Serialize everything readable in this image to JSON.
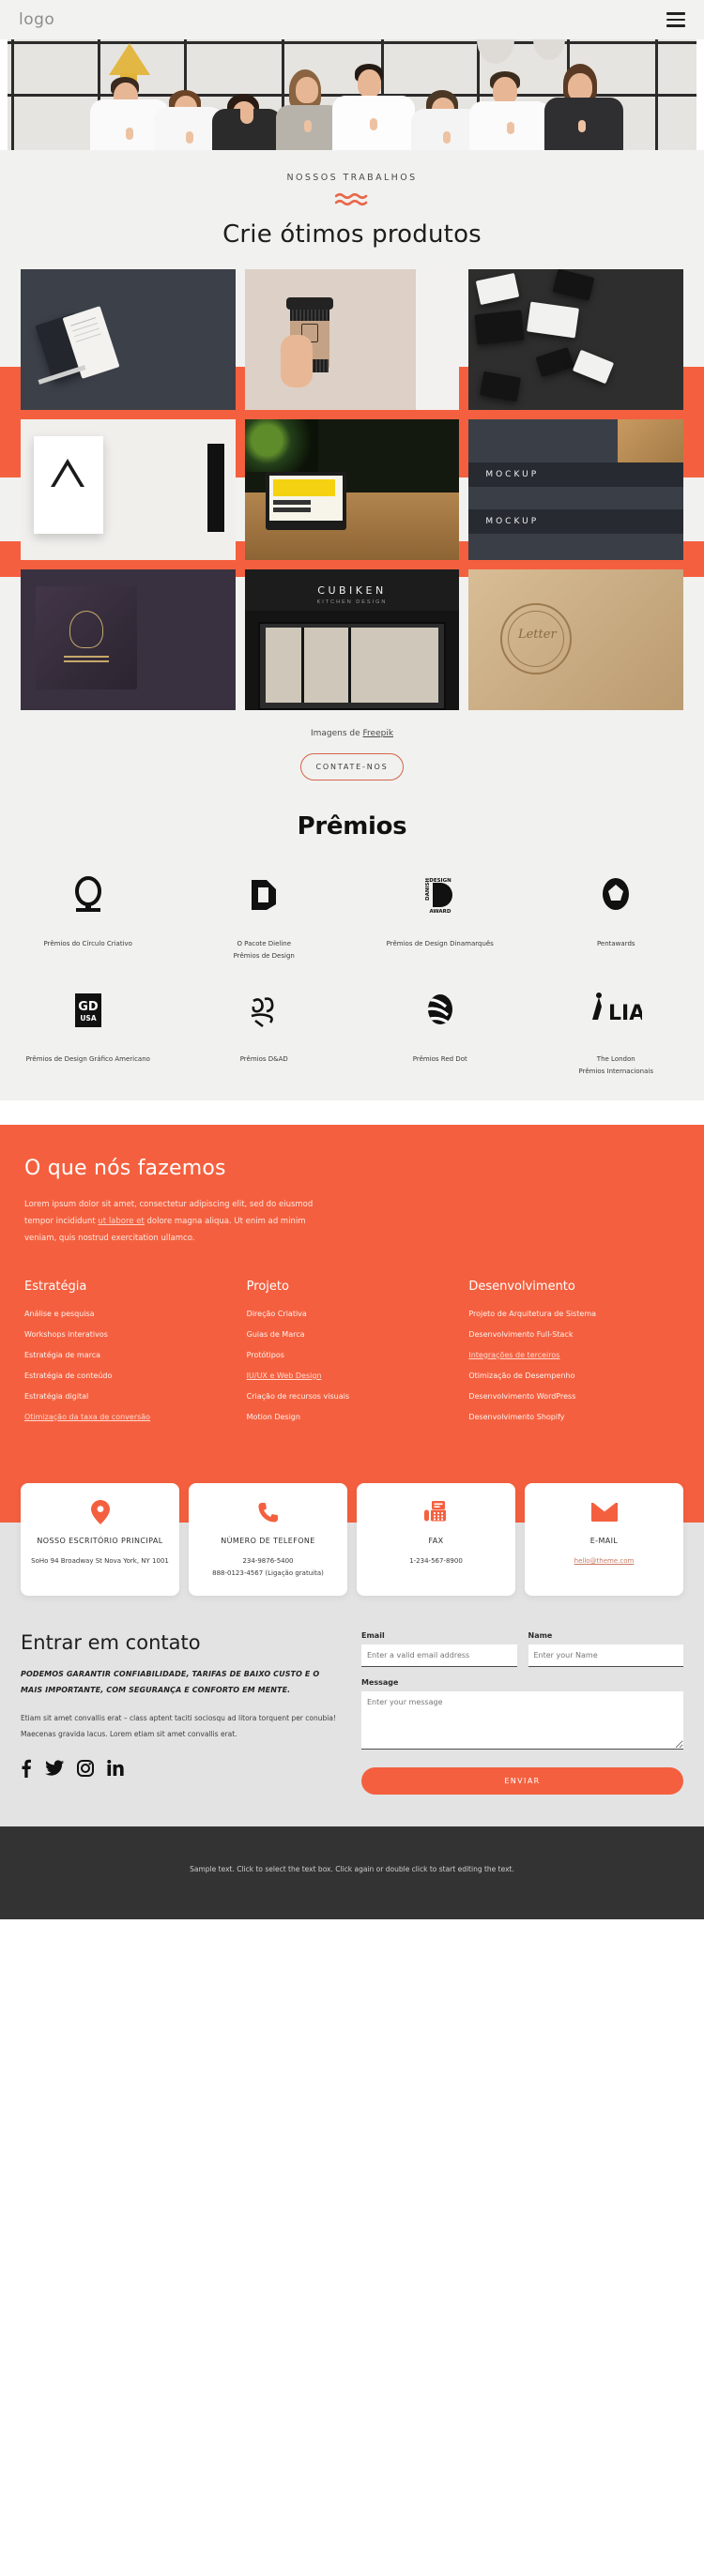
{
  "nav": {
    "logo": "logo",
    "menu_icon": "hamburger-icon"
  },
  "hero": {
    "alt": "team giving thumbs up"
  },
  "works": {
    "eyebrow": "NOSSOS TRABALHOS",
    "title": "Crie ótimos produtos",
    "credit_prefix": "Imagens de ",
    "credit_link": "Freepik",
    "cta": "CONTATE-NOS",
    "tiles": [
      "branding stationery dark",
      "coffee cup mockup",
      "business cards scattered",
      "triangle poster mockup",
      "laptop marketing strategy",
      "mockup banner wood",
      "blue horse club notebook",
      "cubiken kitchen design storefront",
      "letter press kraft stamp"
    ]
  },
  "prizes": {
    "title": "Prêmios",
    "row1": [
      {
        "logo": "creative-circle-icon",
        "label": "Prêmios do Círculo Criativo"
      },
      {
        "logo": "dieline-d-icon",
        "label": "O Pacote Dieline\nPrêmios de Design"
      },
      {
        "logo": "danish-design-award-icon",
        "label": "Prêmios de Design Dinamarquês"
      },
      {
        "logo": "pentawards-icon",
        "label": "Pentawards"
      }
    ],
    "row2": [
      {
        "logo": "gdusa-icon",
        "label": "Prêmios de Design Gráfico Americano"
      },
      {
        "logo": "dand-ad-icon",
        "label": "Prêmios D&AD"
      },
      {
        "logo": "red-dot-icon",
        "label": "Prêmios Red Dot"
      },
      {
        "logo": "lia-icon",
        "label": "The London\nPrêmios Internacionais"
      }
    ]
  },
  "services": {
    "title": "O que nós fazemos",
    "lead_part1": "Lorem ipsum dolor sit amet, consectetur adipiscing elit, sed do eiusmod tempor incididunt ",
    "lead_link": "ut labore et",
    "lead_part2": " dolore magna aliqua. Ut enim ad minim veniam, quis nostrud exercitation ullamco.",
    "columns": [
      {
        "heading": "Estratégia",
        "items": [
          {
            "text": "Análise e pesquisa",
            "link": false
          },
          {
            "text": "Workshops interativos",
            "link": false
          },
          {
            "text": "Estratégia de marca",
            "link": false
          },
          {
            "text": "Estratégia de conteúdo",
            "link": false
          },
          {
            "text": "Estratégia digital",
            "link": false
          },
          {
            "text": "Otimização da taxa de conversão",
            "link": true
          }
        ]
      },
      {
        "heading": "Projeto",
        "items": [
          {
            "text": "Direção Criativa",
            "link": false
          },
          {
            "text": "Guias de Marca",
            "link": false
          },
          {
            "text": "Protótipos",
            "link": false
          },
          {
            "text": "IU/UX e Web Design",
            "link": true
          },
          {
            "text": "Criação de recursos visuais",
            "link": false
          },
          {
            "text": "Motion Design",
            "link": false
          }
        ]
      },
      {
        "heading": "Desenvolvimento",
        "items": [
          {
            "text": "Projeto de Arquitetura de Sistema",
            "link": false
          },
          {
            "text": "Desenvolvimento Full-Stack",
            "link": false
          },
          {
            "text": "Integrações de terceiros",
            "link": true
          },
          {
            "text": "Otimização de Desempenho",
            "link": false
          },
          {
            "text": "Desenvolvimento WordPress",
            "link": false
          },
          {
            "text": "Desenvolvimento Shopify",
            "link": false
          }
        ]
      }
    ]
  },
  "contact_cards": [
    {
      "icon": "map-pin-icon",
      "title": "NOSSO ESCRITÓRIO PRINCIPAL",
      "text": "SoHo 94 Broadway St Nova York, NY 1001",
      "is_link": false
    },
    {
      "icon": "phone-icon",
      "title": "NÚMERO DE TELEFONE",
      "text": "234-9876-5400\n888-0123-4567 (Ligação gratuita)",
      "is_link": false
    },
    {
      "icon": "fax-icon",
      "title": "FAX",
      "text": "1-234-567-8900",
      "is_link": false
    },
    {
      "icon": "envelope-icon",
      "title": "E-MAIL",
      "text": "hello@theme.com",
      "is_link": true
    }
  ],
  "contact": {
    "title": "Entrar em contato",
    "subtitle": "PODEMOS GARANTIR CONFIABILIDADE, TARIFAS DE BAIXO CUSTO E O MAIS IMPORTANTE, COM SEGURANÇA E CONFORTO EM MENTE.",
    "body": "Etiam sit amet convallis erat – class aptent taciti sociosqu ad litora torquent per conubia! Maecenas gravida lacus. Lorem etiam sit amet convallis erat.",
    "socials": [
      "facebook-icon",
      "twitter-icon",
      "instagram-icon",
      "linkedin-icon"
    ],
    "form": {
      "email_label": "Email",
      "email_placeholder": "Enter a valid email address",
      "email_value": "",
      "name_label": "Name",
      "name_placeholder": "Enter your Name",
      "name_value": "",
      "message_label": "Message",
      "message_placeholder": "Enter your message",
      "message_value": "",
      "submit": "ENVIAR"
    }
  },
  "footer": {
    "text": "Sample text. Click to select the text box. Click again or double click to start editing the text."
  },
  "colors": {
    "accent": "#f4603f",
    "light_bg": "#f1f1ef",
    "gray_bg": "#e3e3e3",
    "footer_bg": "#333333"
  }
}
